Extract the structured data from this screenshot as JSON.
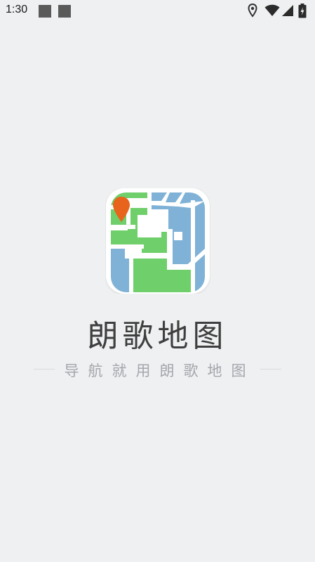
{
  "status_bar": {
    "time": "1:30",
    "icons": [
      "location-icon",
      "wifi-icon",
      "signal-icon",
      "battery-charging-icon"
    ]
  },
  "splash": {
    "app_icon": "map-app-logo-icon",
    "app_name": "朗歌地图",
    "slogan": "导航就用朗歌地图",
    "colors": {
      "background": "#eff0f2",
      "map_green": "#6fcf6a",
      "map_blue": "#7fb2d6",
      "pin_orange": "#e8631c",
      "title_text": "#3f3f3f",
      "slogan_text": "#a4a6ab"
    }
  }
}
